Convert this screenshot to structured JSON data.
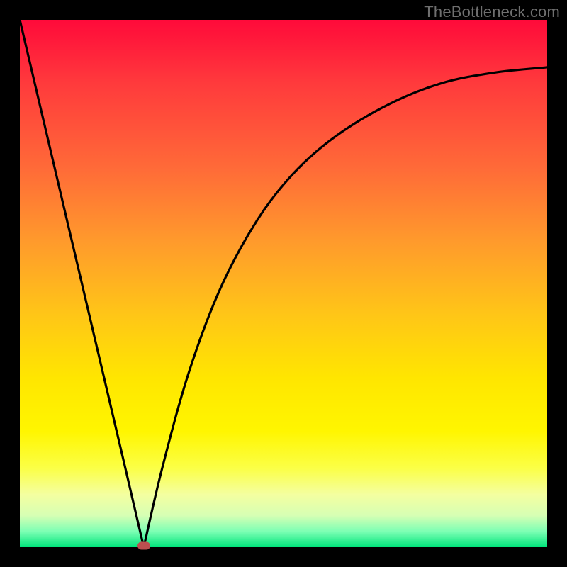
{
  "watermark": "TheBottleneck.com",
  "colors": {
    "background": "#000000",
    "curve": "#000000",
    "marker": "#bb4f4f",
    "gradient_top": "#ff0a3a",
    "gradient_bottom": "#00e57b"
  },
  "chart_data": {
    "type": "line",
    "title": "",
    "xlabel": "",
    "ylabel": "",
    "xlim": [
      0,
      100
    ],
    "ylim": [
      0,
      100
    ],
    "grid": false,
    "legend": false,
    "annotations": [
      {
        "text": "TheBottleneck.com",
        "position": "top-right"
      }
    ],
    "series": [
      {
        "name": "bottleneck-curve",
        "x": [
          0,
          4,
          8,
          12,
          16,
          20,
          23.5,
          27,
          32,
          38,
          45,
          52,
          60,
          70,
          80,
          90,
          100
        ],
        "values": [
          100,
          83,
          66,
          49,
          32,
          15,
          0,
          15,
          33,
          49,
          62,
          71,
          78,
          84,
          88,
          90,
          91
        ]
      }
    ],
    "marker": {
      "x": 23.5,
      "y": 0
    }
  }
}
